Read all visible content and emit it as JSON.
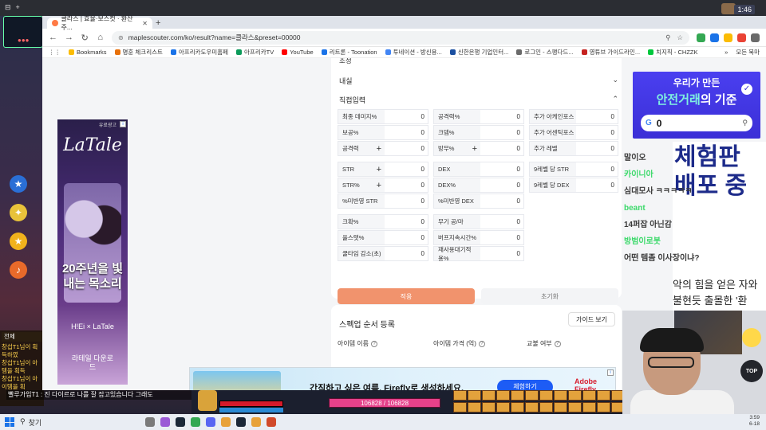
{
  "game": {
    "top_tabs": [
      "⊟",
      "+"
    ],
    "clock": "1:46",
    "chat_header": "전체",
    "chat_lines": [
      "창섭T1님이 획득하였",
      "창섭T1님이 아템을 획득",
      "창섭T1님이 아이템을 획"
    ],
    "bottom_chat": "빨루가입T1 : 진 다이르로 나를 잘 잡고있습니다 그래도",
    "exp_text": "106828 / 106828",
    "top_btn": "TOP",
    "chat_right": [
      {
        "text": "말이오",
        "color": "#3a3a3a"
      },
      {
        "text": "카이니아",
        "color": "#3bd96a"
      },
      {
        "text": "심대모사 ㅋㅋㅋㅋㅋ",
        "color": "#3a3a3a"
      },
      {
        "text": "beant",
        "color": "#3bd96a"
      },
      {
        "text": "14퍼잡 아닌감",
        "color": "#3a3a3a"
      },
      {
        "text": "방범이로봇",
        "color": "#3bd96a"
      },
      {
        "text": "어떤 템좀 이사장이냐?",
        "color": "#3a3a3a"
      }
    ]
  },
  "browser": {
    "tab_title": "클라스 | 효율·보스컷 · 환산주...",
    "tab_close": "✕",
    "new_tab": "+",
    "url": "maplescouter.com/ko/result?name=클라스&preset=00000",
    "bookmarks": [
      {
        "label": "Bookmarks",
        "color": "#fbbc04"
      },
      {
        "label": "명훈 체크리스트",
        "color": "#e8710a"
      },
      {
        "label": "아프리카도우미홈페",
        "color": "#1a73e8"
      },
      {
        "label": "아프리카TV",
        "color": "#0b9a5a"
      },
      {
        "label": "YouTube",
        "color": "#ff0000"
      },
      {
        "label": "리트론 - Toonation",
        "color": "#1a73e8"
      },
      {
        "label": "투네이션 - 방신용...",
        "color": "#4285f4"
      },
      {
        "label": "신한은행 기업인터...",
        "color": "#1a4fa0"
      },
      {
        "label": "로그인 - 스팽다드...",
        "color": "#6a6a6a"
      },
      {
        "label": "영튜브 가이드라인...",
        "color": "#c5221f"
      },
      {
        "label": "치지직 - CHZZK",
        "color": "#00c73c"
      }
    ],
    "bookmarks_more": "»",
    "bookmarks_all": "모든 북마",
    "ext_colors": [
      "#34a853",
      "#1a73e8",
      "#fbbc04",
      "#ea4335",
      "#6a6a6a"
    ]
  },
  "panel": {
    "top_cut": "조정",
    "sec1": "내실",
    "sec2": "직접입력",
    "fields": [
      {
        "label": "최종 데미지%",
        "value": "0",
        "plus": false
      },
      {
        "label": "공격력%",
        "value": "0",
        "plus": false
      },
      {
        "label": "추가 아케인포스",
        "value": "0",
        "plus": false
      },
      {
        "label": "보공%",
        "value": "0",
        "plus": false
      },
      {
        "label": "크뎀%",
        "value": "0",
        "plus": false
      },
      {
        "label": "추가 어센틱포스",
        "value": "0",
        "plus": false
      },
      {
        "label": "공격력",
        "value": "0",
        "plus": true
      },
      {
        "label": "방무%",
        "value": "0",
        "plus": true
      },
      {
        "label": "추가 레벨",
        "value": "0",
        "plus": false
      },
      {
        "label": "STR",
        "value": "0",
        "plus": true
      },
      {
        "label": "DEX",
        "value": "0",
        "plus": false
      },
      {
        "label": "9레벨 당 STR",
        "value": "0",
        "plus": false
      },
      {
        "label": "STR%",
        "value": "0",
        "plus": true
      },
      {
        "label": "DEX%",
        "value": "0",
        "plus": false
      },
      {
        "label": "9레벨 당 DEX",
        "value": "0",
        "plus": false
      },
      {
        "label": "%미반영 STR",
        "value": "0",
        "plus": false
      },
      {
        "label": "%미반영 DEX",
        "value": "0",
        "plus": false
      },
      {
        "label": "크확%",
        "value": "0",
        "plus": false
      },
      {
        "label": "무기 공/마",
        "value": "0",
        "plus": false
      },
      {
        "label": "올스탯%",
        "value": "0",
        "plus": false
      },
      {
        "label": "버프지속시간%",
        "value": "0",
        "plus": false
      },
      {
        "label": "쿨타임 감소(초)",
        "value": "0",
        "plus": false
      },
      {
        "label": "재사용대기적용%",
        "value": "0",
        "plus": false
      }
    ],
    "apply": "적용",
    "reset": "초기화",
    "sec3": "스펙업 순서 등록",
    "guide": "가이드 보기",
    "col1": "아이템 이름",
    "col2": "아이템 가격 (억)",
    "col3": "교불 여부"
  },
  "ads": {
    "left_brand": "LaTale",
    "left_pre": "유료광고",
    "left_tag": "20주년을 빛내는 목소리",
    "left_collab": "H!Ei × LaTale",
    "left_cta": "라테일 다운로드",
    "right_t1": "우리가 만든",
    "right_t2a": "안전거래",
    "right_t2b": "의 기준",
    "right_query": "0",
    "promo_big": "체험판 배포 중",
    "promo_body": "악의 힘을 얻은 자와 불현듯 출몰한 '환마'와의 싸움.",
    "banner_text": "간직하고 싶은 여름, Firefly로 생성하세요.",
    "banner_btn": "체험하기",
    "banner_logo": "Adobe Firefly"
  },
  "taskbar": {
    "search": "찾기",
    "time": "3:59",
    "date": "6-18"
  }
}
